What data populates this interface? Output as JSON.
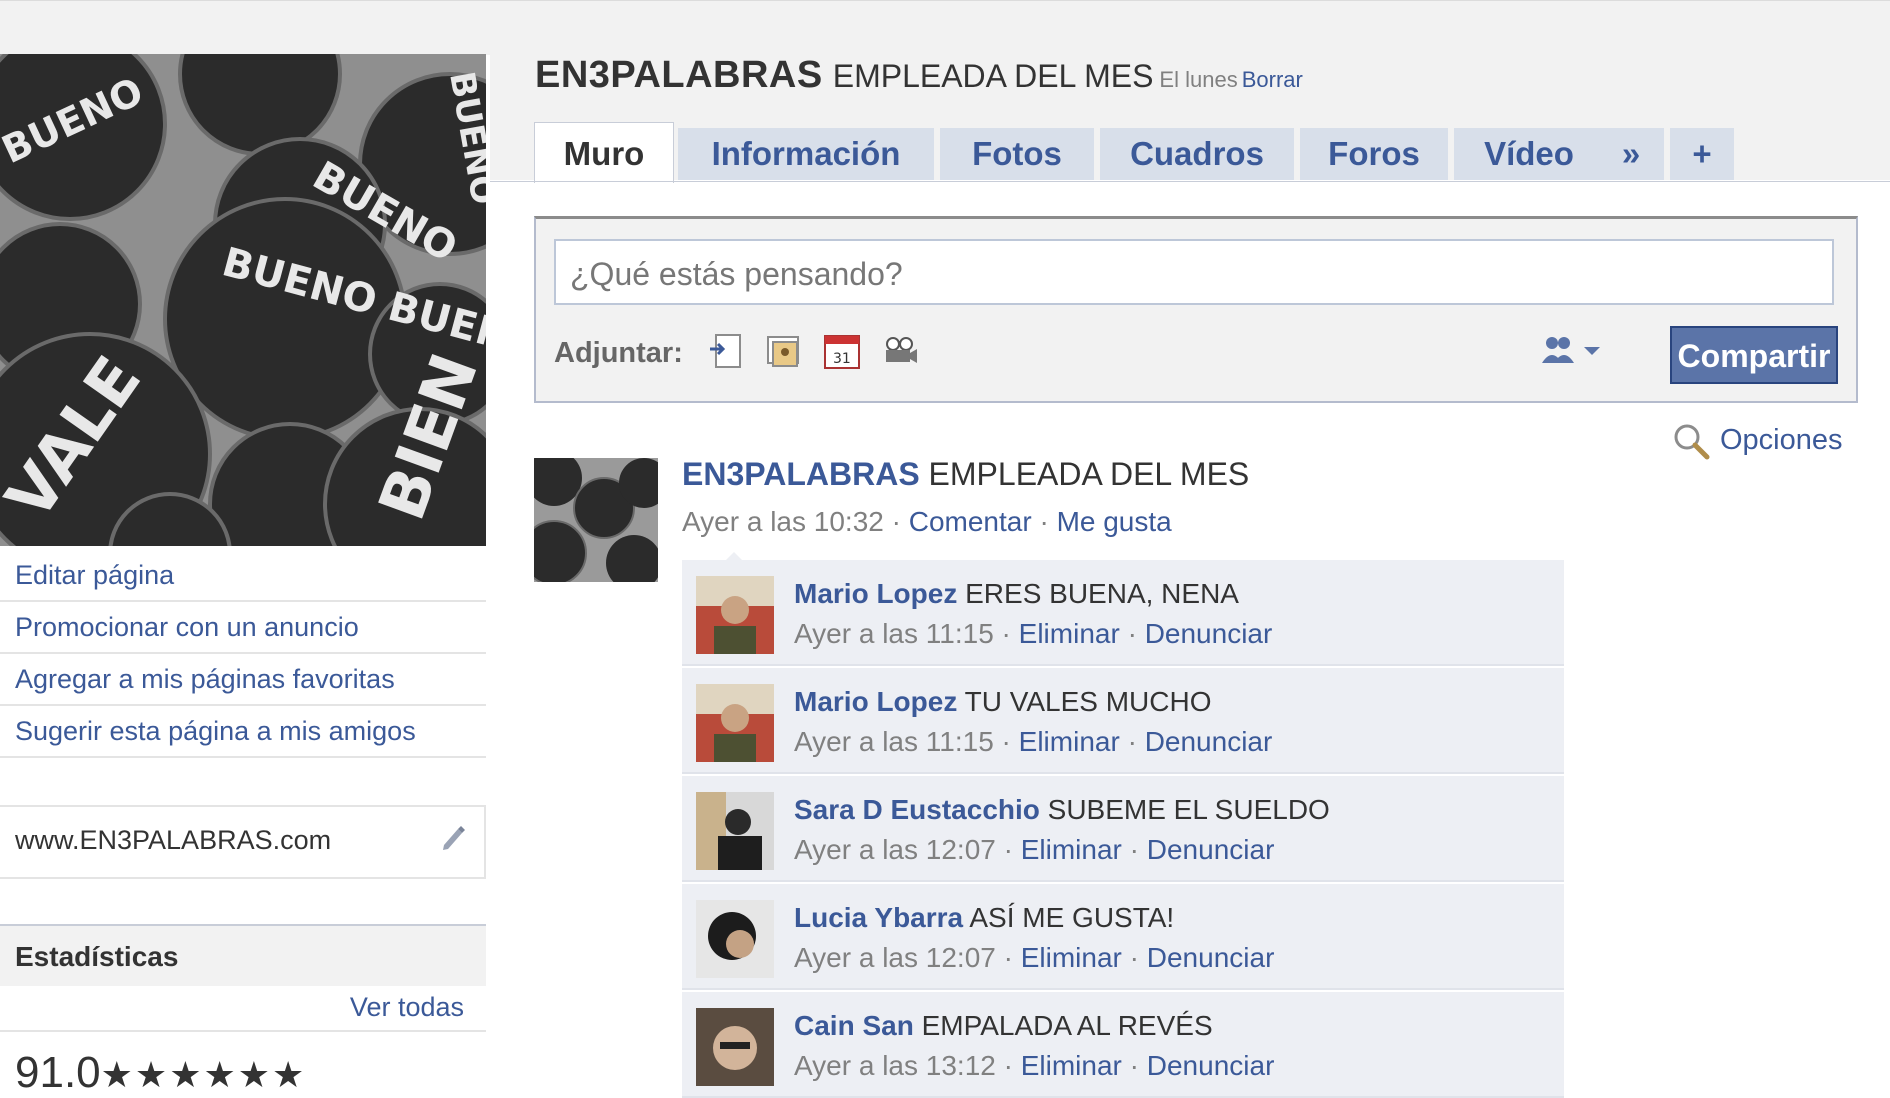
{
  "header": {
    "page_name": "EN3PALABRAS",
    "status": "EMPLEADA DEL MES",
    "when": "El lunes",
    "delete_link": "Borrar"
  },
  "tabs": [
    {
      "label": "Muro",
      "active": true
    },
    {
      "label": "Información"
    },
    {
      "label": "Fotos"
    },
    {
      "label": "Cuadros"
    },
    {
      "label": "Foros"
    },
    {
      "label": "Vídeo"
    },
    {
      "label": "»",
      "icon": "more-tabs-icon"
    },
    {
      "label": "+",
      "icon": "add-tab-icon"
    }
  ],
  "composer": {
    "placeholder": "¿Qué estás pensando?",
    "attach_label": "Adjuntar:",
    "attach_icons": [
      "link-icon",
      "photo-icon",
      "event-icon",
      "video-icon"
    ],
    "privacy_icon": "friends-privacy-icon",
    "share_label": "Compartir"
  },
  "options_label": "Opciones",
  "profile_picture": {
    "button_words": [
      "BUENO",
      "BUENO BUENO BUENO",
      "BUENO",
      "VALE",
      "BIEN",
      "BUENO"
    ]
  },
  "sidebar": {
    "links": [
      "Editar página",
      "Promocionar con un anuncio",
      "Agregar a mis páginas favoritas",
      "Sugerir esta página a mis amigos"
    ],
    "website": "www.EN3PALABRAS.com",
    "stats_title": "Estadísticas",
    "see_all": "Ver todas",
    "rating_value": "91.0",
    "rating_stars": "★★★★★★"
  },
  "post": {
    "author": "EN3PALABRAS",
    "message": "EMPLEADA DEL MES",
    "time": "Ayer a las 10:32",
    "comment_link": "Comentar",
    "like_link": "Me gusta",
    "separator": "·"
  },
  "comments": [
    {
      "name": "Mario Lopez",
      "text": "ERES BUENA, NENA",
      "time": "Ayer a las 11:15",
      "delete": "Eliminar",
      "report": "Denunciar"
    },
    {
      "name": "Mario Lopez",
      "text": "TU VALES MUCHO",
      "time": "Ayer a las 11:15",
      "delete": "Eliminar",
      "report": "Denunciar"
    },
    {
      "name": "Sara D Eustacchio",
      "text": "SUBEME EL SUELDO",
      "time": "Ayer a las 12:07",
      "delete": "Eliminar",
      "report": "Denunciar"
    },
    {
      "name": "Lucia Ybarra",
      "text": "ASÍ ME GUSTA!",
      "time": "Ayer a las 12:07",
      "delete": "Eliminar",
      "report": "Denunciar"
    },
    {
      "name": "Cain San",
      "text": "EMPALADA AL REVÉS",
      "time": "Ayer a las 13:12",
      "delete": "Eliminar",
      "report": "Denunciar"
    }
  ],
  "colors": {
    "link_blue": "#3b5998",
    "tab_bg": "#d8dfea",
    "button_blue": "#5b74a8",
    "comment_bg": "#edeff4"
  }
}
